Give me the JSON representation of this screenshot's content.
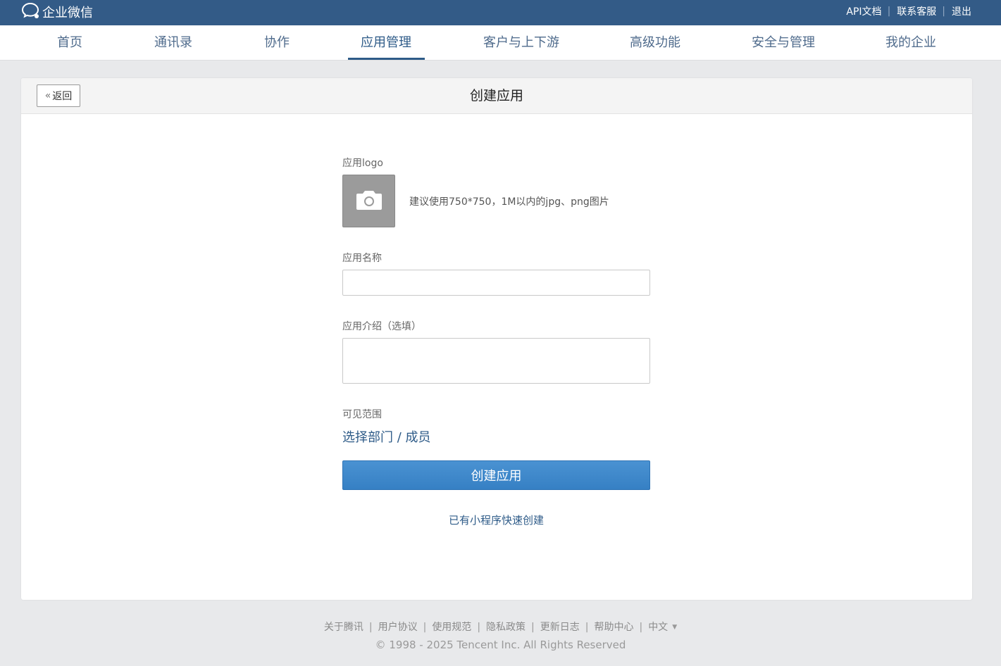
{
  "topbar": {
    "logo_text": "企业微信",
    "links": [
      "API文档",
      "联系客服",
      "退出"
    ]
  },
  "nav": {
    "items": [
      "首页",
      "通讯录",
      "协作",
      "应用管理",
      "客户与上下游",
      "高级功能",
      "安全与管理",
      "我的企业"
    ],
    "active": "应用管理"
  },
  "card": {
    "back_label": "返回",
    "title": "创建应用"
  },
  "form": {
    "logo_label": "应用logo",
    "logo_hint": "建议使用750*750，1M以内的jpg、png图片",
    "name_label": "应用名称",
    "name_value": "",
    "intro_label": "应用介绍（选填）",
    "intro_value": "",
    "scope_label": "可见范围",
    "scope_link": "选择部门 / 成员",
    "submit_label": "创建应用",
    "mini_program_link": "已有小程序快速创建"
  },
  "footer": {
    "links": [
      "关于腾讯",
      "用户协议",
      "使用规范",
      "隐私政策",
      "更新日志",
      "帮助中心"
    ],
    "language": "中文",
    "copyright": "© 1998 - 2025 Tencent Inc. All Rights Reserved"
  },
  "colors": {
    "topbar": "#335b87",
    "accent": "#2e5b88",
    "primary_button": "#3d87c9"
  },
  "icons": {
    "logo": "wecom-logo-icon",
    "back": "double-chevron-left-icon",
    "upload": "camera-icon",
    "language_dropdown": "triangle-down-icon"
  }
}
